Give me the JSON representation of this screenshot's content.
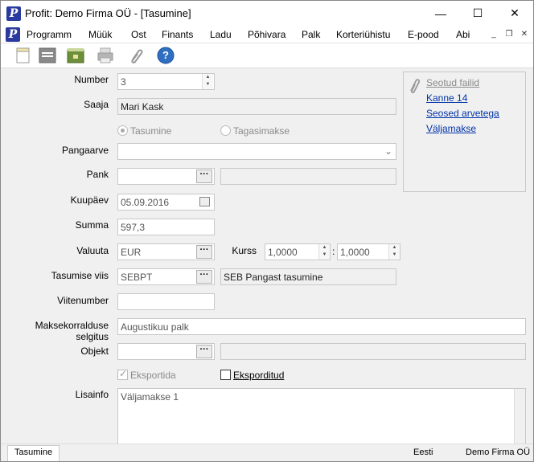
{
  "titlebar": {
    "title": "Profit: Demo Firma OÜ - [Tasumine]",
    "minimize_glyph": "—",
    "maximize_glyph": "☐",
    "close_glyph": "✕",
    "logo_letter": "P"
  },
  "menu": {
    "items": [
      "Programm",
      "Müük",
      "Ost",
      "Finants",
      "Ladu",
      "Põhivara",
      "Palk",
      "Korteriühistu",
      "E-pood",
      "Abi"
    ],
    "mdi_min": "_",
    "mdi_restore": "❐",
    "mdi_close": "✕"
  },
  "toolbar": {
    "icons": [
      "new-document-icon",
      "list-icon",
      "lock-folder-icon",
      "print-icon",
      "attach-icon",
      "help-icon"
    ],
    "help_glyph": "?"
  },
  "form": {
    "number_label": "Number",
    "number_value": "3",
    "payee_label": "Saaja",
    "payee_value": "Mari Kask",
    "radio_payment": "Tasumine",
    "radio_refund": "Tagasimakse",
    "account_label": "Pangaarve",
    "account_value": "",
    "bank_label": "Pank",
    "bank_value": "",
    "bank_name_value": "",
    "date_label": "Kuupäev",
    "date_value": "05.09.2016",
    "amount_label": "Summa",
    "amount_value": "597,3",
    "currency_label": "Valuuta",
    "currency_value": "EUR",
    "rate_label": "Kurss",
    "rate_value_1": "1,0000",
    "rate_separator": ":",
    "rate_value_2": "1,0000",
    "method_label": "Tasumise viis",
    "method_code": "SEBPT",
    "method_name": "SEB Pangast tasumine",
    "reference_label": "Viitenumber",
    "reference_value": "",
    "description_label": "Maksekorralduse selgitus",
    "description_value": "Augustikuu palk",
    "object_label": "Objekt",
    "object_value": "",
    "object_name_value": "",
    "export_label": "Eksportida",
    "exported_label": "Eksporditud",
    "notes_label": "Lisainfo",
    "notes_value": "Väljamakse 1",
    "dots": "···"
  },
  "links": {
    "header": "Seotud failid",
    "items": [
      "Kanne 14",
      "Seosed arvetega",
      "Väljamakse"
    ]
  },
  "status": {
    "tab": "Tasumine",
    "language": "Eesti",
    "company": "Demo Firma OÜ"
  },
  "colors": {
    "logo_blue": "#2b3a9e",
    "link_blue": "#0033aa",
    "help_blue": "#2f6fc1"
  }
}
